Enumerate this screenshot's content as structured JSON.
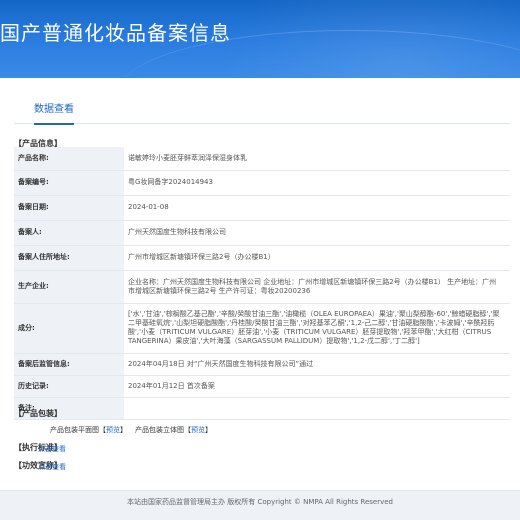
{
  "header": {
    "title": "国产普通化妆品备案信息"
  },
  "tabs": [
    {
      "label": "数据查看",
      "active": true
    }
  ],
  "product_info": {
    "section_title": "【产品信息】",
    "rows": [
      {
        "label": "产品名称:",
        "value": "诺敏婷玲小麦胚芽鲜萃润泽保湿身体乳"
      },
      {
        "label": "备案编号:",
        "value": "粤G妆网备字2024014943"
      },
      {
        "label": "备案日期:",
        "value": "2024-01-08"
      },
      {
        "label": "备案人:",
        "value": "广州天然国度生物科技有限公司"
      },
      {
        "label": "备案人住所地址:",
        "value": "广州市增城区新塘镇环保三路2号（办公楼B1）"
      },
      {
        "label": "生产企业:",
        "value": "企业名称：广州天然国度生物科技有限公司 企业地址：广州市增城区新塘镇环保三路2号（办公楼B1） 生产地址：广州市增城区新塘镇环保三路2号 生产许可证：粤妆20200236"
      },
      {
        "label": "成分:",
        "value": "['水','甘油','棕榈酸乙基己酯','辛酸/癸酸甘油三酯','油橄榄（OLEA EUROPAEA）果油','聚山梨醇酯-60','鲸蜡硬脂醇','聚二甲基硅氧烷','山梨坦硬脂酸酯','丹桂酸/癸酸甘油三酯','对羟基苯乙酮','1,2-己二醇','甘油硬脂酸酯','卡波姆','辛酰羟肟酸','小麦（TRITICUM VULGARE）胚芽油','小麦（TRITICUM VULGARE）胚芽提取物','羟苯甲酯','大红柑（CITRUS TANGERINA）果皮油','大叶海藻（SARGASSUM PALLIDUM）提取物','1,2-戊二醇','丁二醇']"
      },
      {
        "label": "备案后监管信息:",
        "value": "2024年04月18日 对“广州天然国度生物科技有限公司”通过"
      },
      {
        "label": "历史记录:",
        "value": "2024年01月12日 首次备案"
      },
      {
        "label": "备注:",
        "value": ""
      }
    ]
  },
  "packaging": {
    "section_title": "【产品包装】",
    "items": [
      {
        "label": "产品包装平面图",
        "bracket_open": "【",
        "link": "预览",
        "bracket_close": "】"
      },
      {
        "label": "产品包装立体图",
        "bracket_open": "【",
        "link": "预览",
        "bracket_close": "】"
      }
    ]
  },
  "standard": {
    "section_title": "【执行标准】",
    "link": "点击查看"
  },
  "safety": {
    "section_title": "【功效宣称】",
    "link": "点击查看"
  },
  "footer": {
    "text": "本站由国家药品监督管理局主办 版权所有 Copyright © NMPA All Rights Reserved"
  },
  "colors": {
    "header_blue": "#1466c6",
    "link_blue": "#1e67c2",
    "label_bg": "#eef2f6"
  }
}
